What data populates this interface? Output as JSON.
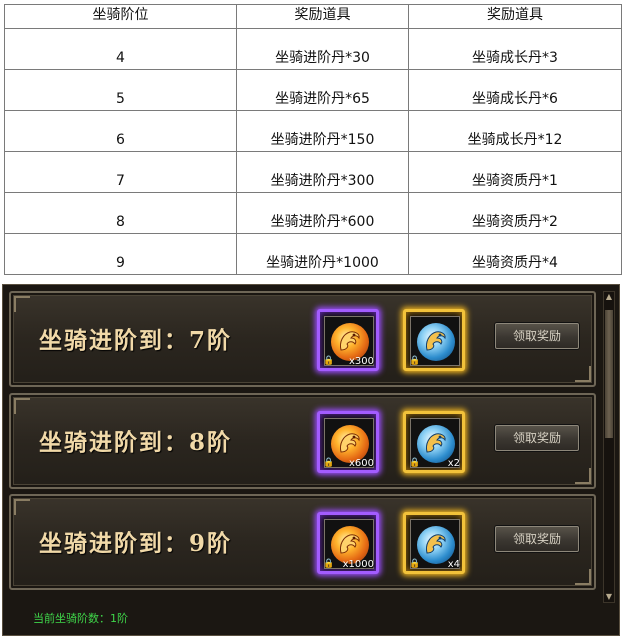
{
  "table": {
    "headers": [
      "坐骑阶位",
      "奖励道具",
      "奖励道具"
    ],
    "rows": [
      [
        "4",
        "坐骑进阶丹*30",
        "坐骑成长丹*3"
      ],
      [
        "5",
        "坐骑进阶丹*65",
        "坐骑成长丹*6"
      ],
      [
        "6",
        "坐骑进阶丹*150",
        "坐骑成长丹*12"
      ],
      [
        "7",
        "坐骑进阶丹*300",
        "坐骑资质丹*1"
      ],
      [
        "8",
        "坐骑进阶丹*600",
        "坐骑资质丹*2"
      ],
      [
        "9",
        "坐骑进阶丹*1000",
        "坐骑资质丹*4"
      ]
    ]
  },
  "panel": {
    "tiers": [
      {
        "title": "坐骑进阶到：7阶",
        "items": [
          {
            "icon": "dragon-fire-icon",
            "rarity": "purple",
            "qty": "x300",
            "locked": true
          },
          {
            "icon": "dragon-ice-icon",
            "rarity": "gold",
            "qty": "",
            "locked": true
          }
        ],
        "button": "领取奖励"
      },
      {
        "title": "坐骑进阶到：8阶",
        "items": [
          {
            "icon": "dragon-fire-icon",
            "rarity": "purple",
            "qty": "x600",
            "locked": true
          },
          {
            "icon": "dragon-ice-icon",
            "rarity": "gold",
            "qty": "x2",
            "locked": true
          }
        ],
        "button": "领取奖励"
      },
      {
        "title": "坐骑进阶到：9阶",
        "items": [
          {
            "icon": "dragon-fire-icon",
            "rarity": "purple",
            "qty": "x1000",
            "locked": true
          },
          {
            "icon": "dragon-ice-icon",
            "rarity": "gold",
            "qty": "x4",
            "locked": true
          }
        ],
        "button": "领取奖励"
      }
    ],
    "status": "当前坐骑阶数：1阶"
  },
  "colors": {
    "purple_glow": "#a35cff",
    "gold_glow": "#f2c23a",
    "title_text": "#f1d9a8",
    "status_text": "#3fd64a"
  }
}
